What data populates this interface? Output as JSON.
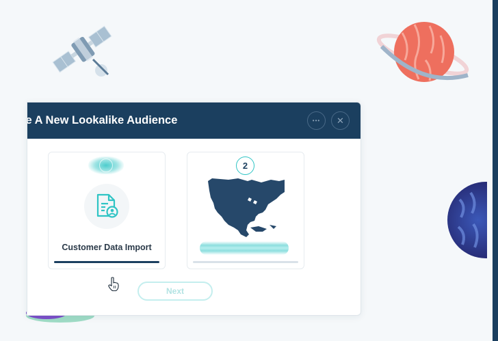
{
  "modal": {
    "title": "te A New Lookalike Audience",
    "more_icon": "more-horizontal-icon",
    "close_icon": "close-icon",
    "more_glyph": "•••",
    "close_glyph": "✕"
  },
  "steps": [
    {
      "label": "Customer Data Import",
      "icon": "document-user-icon",
      "completed": 1.0
    },
    {
      "number": "2",
      "icon": "north-america-map",
      "completed": 0.0
    }
  ],
  "footer": {
    "next_label": "Next"
  },
  "colors": {
    "header": "#1b3f5f",
    "accent": "#2ec4c4",
    "text": "#2b3a49",
    "track": "#d9e1e8"
  }
}
